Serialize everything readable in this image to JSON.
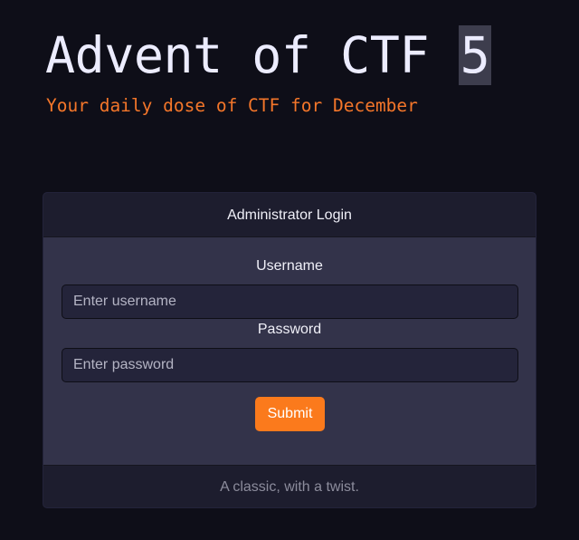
{
  "hero": {
    "title": "Advent of CTF ",
    "day_number": "5",
    "subtitle": "Your daily dose of CTF for December"
  },
  "login_card": {
    "header": "Administrator Login",
    "username_label": "Username",
    "username_placeholder": "Enter username",
    "username_value": "",
    "password_label": "Password",
    "password_placeholder": "Enter password",
    "password_value": "",
    "submit_label": "Submit",
    "footer_text": "A classic, with a twist."
  },
  "colors": {
    "background": "#0e0e18",
    "title_text": "#ececff",
    "subtitle_accent": "#f4762a",
    "submit_button": "#fb7a1c",
    "card_body": "#33334a",
    "card_header_footer": "#1d1d2e"
  }
}
